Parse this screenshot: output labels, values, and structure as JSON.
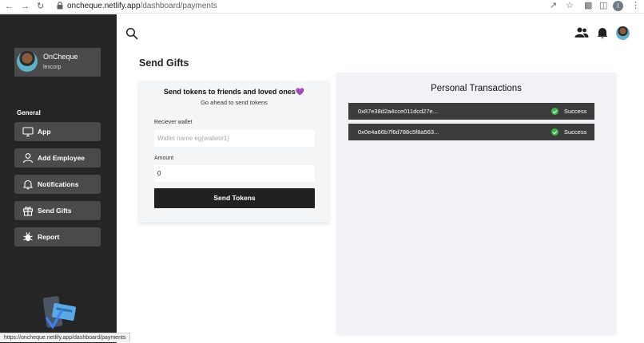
{
  "browser": {
    "url_host": "oncheque.netlify.app",
    "url_path": "/dashboard/payments",
    "profile_initial": "I"
  },
  "sidebar": {
    "profile": {
      "name": "OnCheque",
      "org": "lexcorp"
    },
    "section_label": "General",
    "items": [
      {
        "label": "App",
        "icon": "monitor-icon"
      },
      {
        "label": "Add Employee",
        "icon": "user-icon"
      },
      {
        "label": "Notifications",
        "icon": "bell-icon"
      },
      {
        "label": "Send Gifts",
        "icon": "gift-icon"
      },
      {
        "label": "Report",
        "icon": "bug-icon"
      }
    ]
  },
  "main": {
    "title": "Send Gifts",
    "gift_form": {
      "heading": "Send tokens to friends and loved ones",
      "heading_emoji": "💜",
      "subheading": "Go ahead to send tokens",
      "wallet_label": "Reciever wallet",
      "wallet_placeholder": "Wallet name eg(wallet#1)",
      "wallet_value": "",
      "amount_label": "Amount",
      "amount_value": "0",
      "send_label": "Send Tokens"
    },
    "transactions": {
      "title": "Personal Transactions",
      "rows": [
        {
          "hash": "0x87e38d2a4cce011dcd27e...",
          "status": "Success"
        },
        {
          "hash": "0x0e4a66b7f6d788c5f8a563...",
          "status": "Success"
        }
      ]
    }
  },
  "statusbar": {
    "text": "https://oncheque.netlify.app/dashboard/payments"
  },
  "colors": {
    "sidebar_bg": "#252525",
    "sidebar_item_bg": "#4a4a4a",
    "button_dark": "#212121",
    "row_bg": "#3c3c3c",
    "success": "#3bb54a"
  }
}
